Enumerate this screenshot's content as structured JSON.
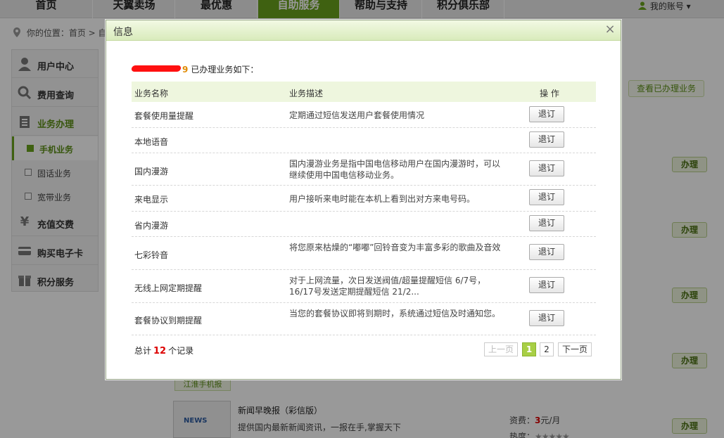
{
  "topnav": {
    "items": [
      "首页",
      "天翼卖场",
      "最优惠",
      "自助服务",
      "帮助与支持",
      "积分俱乐部"
    ],
    "account": "我的账号"
  },
  "breadcrumb": {
    "prefix": "你的位置：首页 > 自"
  },
  "sidebar": {
    "sections": [
      "用户中心",
      "费用查询",
      "业务办理"
    ],
    "sub_items": [
      "手机业务",
      "固话业务",
      "宽带业务"
    ],
    "bottom_sections": [
      "充值交费",
      "购买电子卡",
      "积分服务"
    ]
  },
  "background": {
    "view_link": "查看已办理业务",
    "handle_label": "办理",
    "tag": "江淮手机报",
    "news_thumb": "NEWS",
    "news_title": "新闻早晚报（彩信版）",
    "news_desc": "提供国内最新新闻资讯，一报在手,掌握天下",
    "fee_label": "资费：",
    "fee_value": "3",
    "fee_unit": "元/月",
    "hot_label": "热度：",
    "stars": "★★★★★"
  },
  "modal": {
    "title": "信息",
    "close": "×",
    "intro_num_tail": "9",
    "intro_text": "已办理业务如下：",
    "headers": [
      "业务名称",
      "业务描述",
      "操 作"
    ],
    "unsub_label": "退订",
    "rows": [
      {
        "name": "套餐使用量提醒",
        "desc": "定期通过短信发送用户套餐使用情况"
      },
      {
        "name": "本地语音",
        "desc": ""
      },
      {
        "name": "国内漫游",
        "desc": "国内漫游业务是指中国电信移动用户在国内漫游时，可以继续使用中国电信移动业务。"
      },
      {
        "name": "来电显示",
        "desc": "用户接听来电时能在本机上看到出对方来电号码。"
      },
      {
        "name": "省内漫游",
        "desc": ""
      },
      {
        "name": "七彩铃音",
        "desc": "将您原来枯燥的“嘟嘟”回铃音变为丰富多彩的歌曲及音效"
      },
      {
        "name": "无线上网定期提醒",
        "desc": "对于上网流量，次日发送阀值/超量提醒短信 6/7号，16/17号发送定期提醒短信 21/2..."
      },
      {
        "name": "套餐协议到期提醒",
        "desc": "当您的套餐协议即将到期时，系统通过短信及时通知您。"
      }
    ],
    "total_prefix": "总计",
    "total_count": "12",
    "total_suffix": "个记录",
    "pagination": {
      "prev": "上一页",
      "pages": [
        "1",
        "2"
      ],
      "current": "1",
      "next": "下一页"
    }
  }
}
